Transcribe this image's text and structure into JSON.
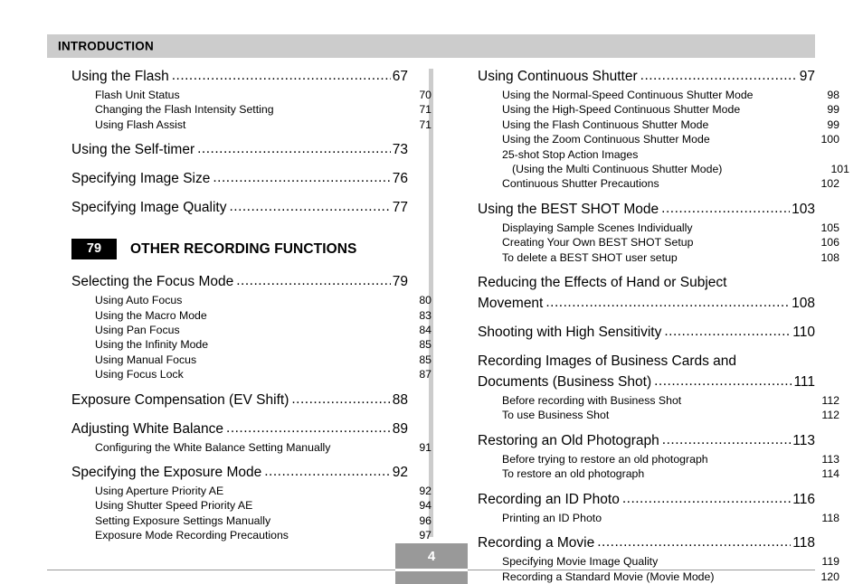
{
  "header": {
    "title": "INTRODUCTION"
  },
  "footer": {
    "page_number": "4"
  },
  "chapter": {
    "number": "79",
    "title": "OTHER RECORDING FUNCTIONS"
  },
  "left_column": {
    "group1": [
      {
        "label": "Using the Flash",
        "page": "67",
        "level": "main"
      },
      {
        "label": "Flash Unit Status",
        "page": "70",
        "level": "sub"
      },
      {
        "label": "Changing the Flash Intensity Setting",
        "page": "71",
        "level": "sub"
      },
      {
        "label": "Using Flash Assist",
        "page": "71",
        "level": "sub"
      },
      {
        "label": "Using the Self-timer",
        "page": "73",
        "level": "main"
      },
      {
        "label": "Specifying Image Size",
        "page": "76",
        "level": "main"
      },
      {
        "label": "Specifying Image Quality",
        "page": "77",
        "level": "main"
      }
    ],
    "group2": [
      {
        "label": "Selecting the Focus Mode",
        "page": "79",
        "level": "main"
      },
      {
        "label": "Using Auto Focus",
        "page": "80",
        "level": "sub"
      },
      {
        "label": "Using the Macro Mode",
        "page": "83",
        "level": "sub"
      },
      {
        "label": "Using Pan Focus",
        "page": "84",
        "level": "sub"
      },
      {
        "label": "Using the Infinity Mode",
        "page": "85",
        "level": "sub"
      },
      {
        "label": "Using Manual Focus",
        "page": "85",
        "level": "sub"
      },
      {
        "label": "Using Focus Lock",
        "page": "87",
        "level": "sub"
      },
      {
        "label": "Exposure Compensation (EV Shift)",
        "page": "88",
        "level": "main"
      },
      {
        "label": "Adjusting White Balance",
        "page": "89",
        "level": "main"
      },
      {
        "label": "Configuring the White Balance Setting Manually",
        "page": "91",
        "level": "sub"
      },
      {
        "label": "Specifying the Exposure Mode",
        "page": "92",
        "level": "main"
      },
      {
        "label": "Using Aperture Priority AE",
        "page": "92",
        "level": "sub"
      },
      {
        "label": "Using Shutter Speed Priority AE",
        "page": "94",
        "level": "sub"
      },
      {
        "label": "Setting Exposure Settings Manually",
        "page": "96",
        "level": "sub"
      },
      {
        "label": "Exposure Mode Recording Precautions",
        "page": "97",
        "level": "sub"
      }
    ]
  },
  "right_column": {
    "entries": [
      {
        "label": "Using Continuous Shutter",
        "page": "97",
        "level": "main"
      },
      {
        "label": "Using the Normal-Speed Continuous Shutter Mode",
        "page": "98",
        "level": "sub"
      },
      {
        "label": "Using the High-Speed Continuous Shutter Mode",
        "page": "99",
        "level": "sub"
      },
      {
        "label": "Using the Flash Continuous Shutter Mode",
        "page": "99",
        "level": "sub"
      },
      {
        "label": "Using the Zoom Continuous Shutter Mode",
        "page": "100",
        "level": "sub"
      },
      {
        "label": "25-shot Stop Action Images",
        "page": "",
        "level": "sub"
      },
      {
        "label": "(Using the Multi Continuous Shutter Mode)",
        "page": "101",
        "level": "sub-indent"
      },
      {
        "label": "Continuous Shutter Precautions",
        "page": "102",
        "level": "sub"
      },
      {
        "label": "Using the BEST SHOT Mode",
        "page": "103",
        "level": "main"
      },
      {
        "label": "Displaying Sample Scenes Individually",
        "page": "105",
        "level": "sub"
      },
      {
        "label": "Creating Your Own BEST SHOT Setup",
        "page": "106",
        "level": "sub"
      },
      {
        "label": "To delete a BEST SHOT user setup",
        "page": "108",
        "level": "sub"
      },
      {
        "label": "Reducing the Effects of Hand or Subject",
        "page": "",
        "level": "main-wrap-first"
      },
      {
        "label": "Movement",
        "page": "108",
        "level": "main-wrap-second"
      },
      {
        "label": "Shooting with High Sensitivity",
        "page": "110",
        "level": "main"
      },
      {
        "label": "Recording Images of Business Cards and",
        "page": "",
        "level": "main-wrap-first"
      },
      {
        "label": "Documents (Business Shot)",
        "page": "111",
        "level": "main-wrap-second"
      },
      {
        "label": "Before recording with Business Shot",
        "page": "112",
        "level": "sub"
      },
      {
        "label": "To use Business Shot",
        "page": "112",
        "level": "sub"
      },
      {
        "label": "Restoring an Old Photograph",
        "page": "113",
        "level": "main"
      },
      {
        "label": "Before trying to restore an old photograph",
        "page": "113",
        "level": "sub"
      },
      {
        "label": "To restore an old photograph",
        "page": "114",
        "level": "sub"
      },
      {
        "label": "Recording an ID Photo",
        "page": "116",
        "level": "main"
      },
      {
        "label": "Printing an ID Photo",
        "page": "118",
        "level": "sub"
      },
      {
        "label": "Recording a Movie",
        "page": "118",
        "level": "main"
      },
      {
        "label": "Specifying Movie Image Quality",
        "page": "119",
        "level": "sub"
      },
      {
        "label": "Recording a Standard Movie (Movie Mode)",
        "page": "120",
        "level": "sub"
      }
    ]
  },
  "colors": {
    "header_bar": "#cccccc",
    "divider": "#cccccc",
    "chapter_block": "#000000",
    "footer_block": "#999999",
    "text": "#000000"
  }
}
